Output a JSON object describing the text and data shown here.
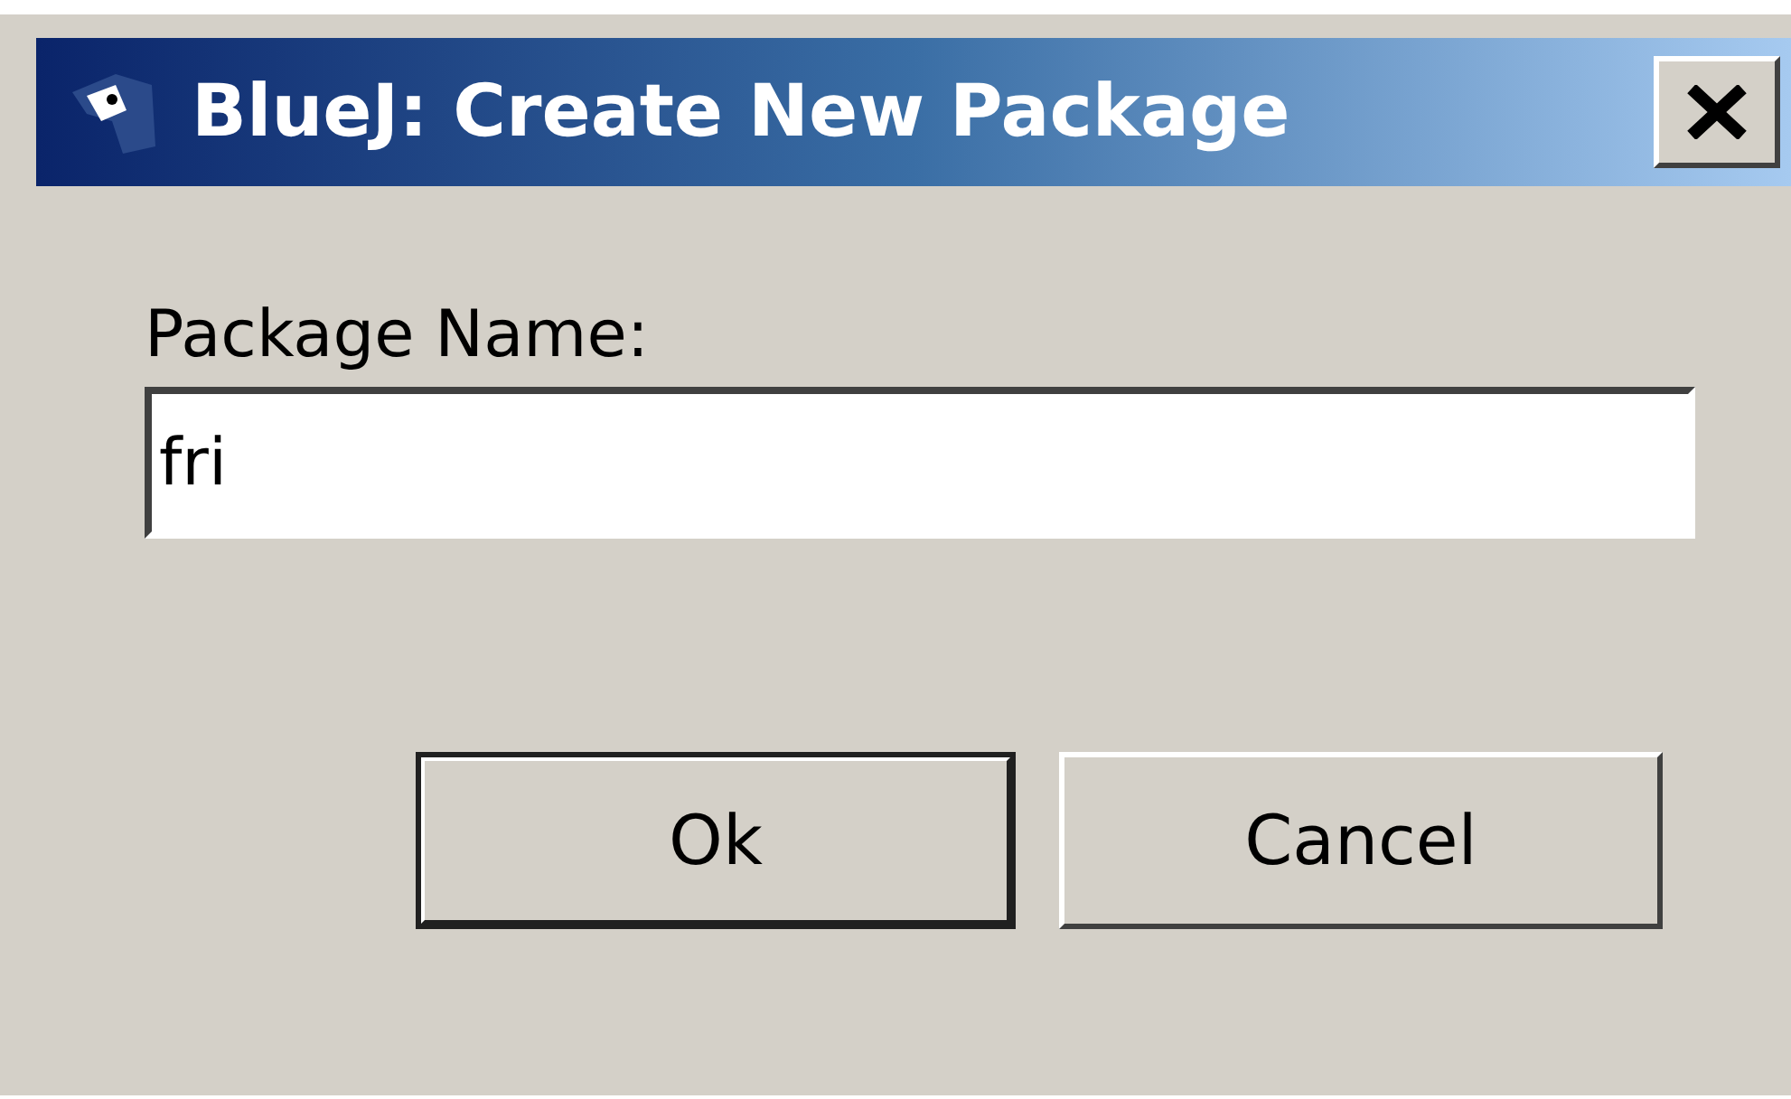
{
  "window": {
    "title": "BlueJ:  Create New Package"
  },
  "field": {
    "label": "Package Name:",
    "value": "fri"
  },
  "buttons": [
    {
      "label": "Ok",
      "default": true
    },
    {
      "label": "Cancel",
      "default": false
    }
  ]
}
